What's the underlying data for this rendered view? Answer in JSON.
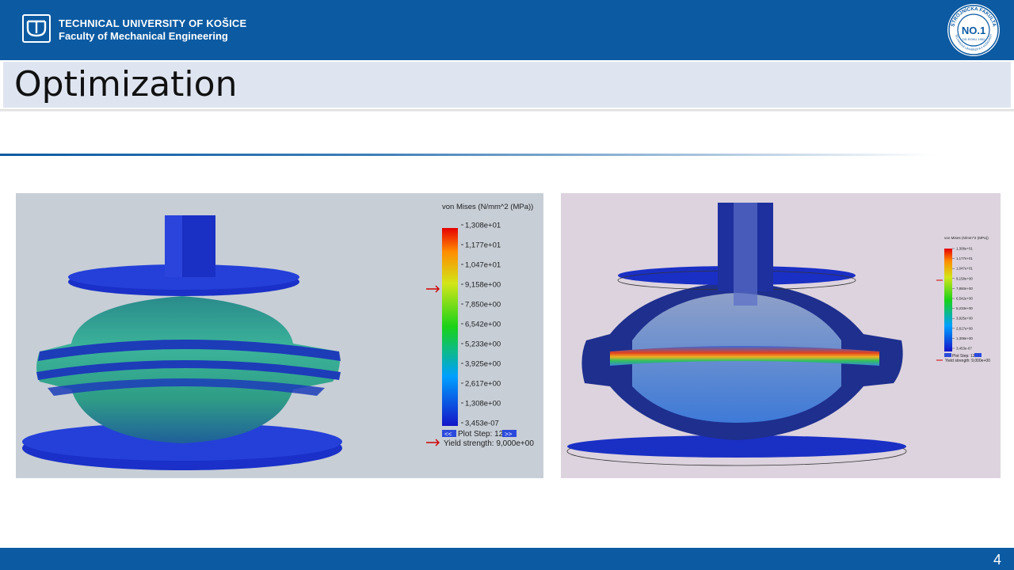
{
  "header": {
    "university": "TECHNICAL UNIVERSITY OF KOŠICE",
    "faculty": "Faculty of Mechanical Engineering",
    "seal": {
      "top_text": "STROJNÍCKA FAKULTA",
      "center_text": "NO.1",
      "sub_text": "OD ROKU 1952",
      "bottom_text": "TECHNICKÁ UNIVERZITA V KOŠICIACH"
    }
  },
  "slide": {
    "title": "Optimization",
    "page_number": "4"
  },
  "colors": {
    "brand_blue": "#0b5aa2",
    "title_band": "#dfe5f0",
    "mesh_blue": "#1a2fc4",
    "left_bg": "#c7ced6",
    "right_bg": "#dcd3de"
  },
  "left_plot": {
    "legend_title": "von Mises (N/mm^2 (MPa))",
    "scale_labels": [
      "1,308e+01",
      "1,177e+01",
      "1,047e+01",
      "9,158e+00",
      "7,850e+00",
      "6,542e+00",
      "5,233e+00",
      "3,925e+00",
      "2,617e+00",
      "1,308e+00",
      "3,453e-07"
    ],
    "plot_step": "Plot Step: 12",
    "yield_strength": "Yield strength: 9,000e+00"
  },
  "right_plot": {
    "legend_title": "von Mises (N/mm^2 (MPa))",
    "scale_labels": [
      "1,308e+01",
      "1,177e+01",
      "1,047e+01",
      "9,158e+00",
      "7,850e+00",
      "6,542e+00",
      "5,233e+00",
      "3,925e+00",
      "2,617e+00",
      "1,308e+00",
      "3,453e-07"
    ],
    "plot_step": "Plot Step: 12",
    "yield_strength": "Yield strength: 9,000e+00"
  }
}
